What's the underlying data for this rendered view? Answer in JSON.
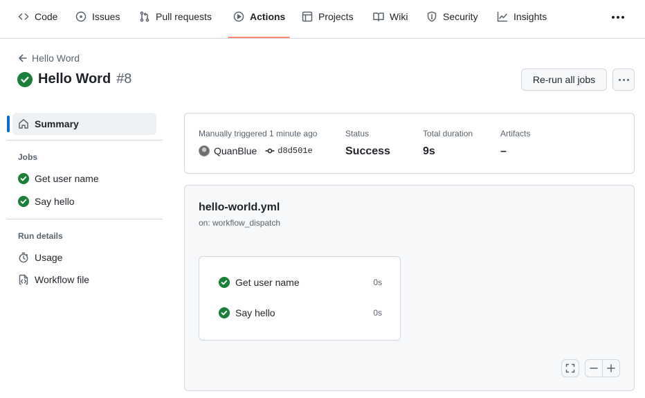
{
  "nav": {
    "tabs": [
      {
        "label": "Code",
        "icon": "code-icon"
      },
      {
        "label": "Issues",
        "icon": "issue-opened-icon"
      },
      {
        "label": "Pull requests",
        "icon": "git-pull-request-icon"
      },
      {
        "label": "Actions",
        "icon": "play-icon",
        "active": true
      },
      {
        "label": "Projects",
        "icon": "table-icon"
      },
      {
        "label": "Wiki",
        "icon": "book-icon"
      },
      {
        "label": "Security",
        "icon": "shield-icon"
      },
      {
        "label": "Insights",
        "icon": "graph-icon"
      }
    ],
    "accent_color": "#fd8c73"
  },
  "header": {
    "back_label": "Hello Word",
    "title": "Hello Word",
    "run_number": "#8",
    "rerun_label": "Re-run all jobs"
  },
  "sidebar": {
    "summary_label": "Summary",
    "jobs_heading": "Jobs",
    "jobs": [
      {
        "label": "Get user name"
      },
      {
        "label": "Say hello"
      }
    ],
    "run_details_heading": "Run details",
    "details": [
      {
        "label": "Usage",
        "icon": "stopwatch-icon"
      },
      {
        "label": "Workflow file",
        "icon": "file-code-icon"
      }
    ]
  },
  "summary": {
    "trigger_label": "Manually triggered 1 minute ago",
    "user": "QuanBlue",
    "commit": "d8d501e",
    "status_label": "Status",
    "status_value": "Success",
    "duration_label": "Total duration",
    "duration_value": "9s",
    "artifacts_label": "Artifacts",
    "artifacts_value": "–"
  },
  "workflow": {
    "file": "hello-world.yml",
    "trigger": "on: workflow_dispatch",
    "jobs": [
      {
        "label": "Get user name",
        "duration": "0s"
      },
      {
        "label": "Say hello",
        "duration": "0s"
      }
    ]
  },
  "colors": {
    "success": "#1a7f37",
    "selected_indicator": "#0969da"
  }
}
